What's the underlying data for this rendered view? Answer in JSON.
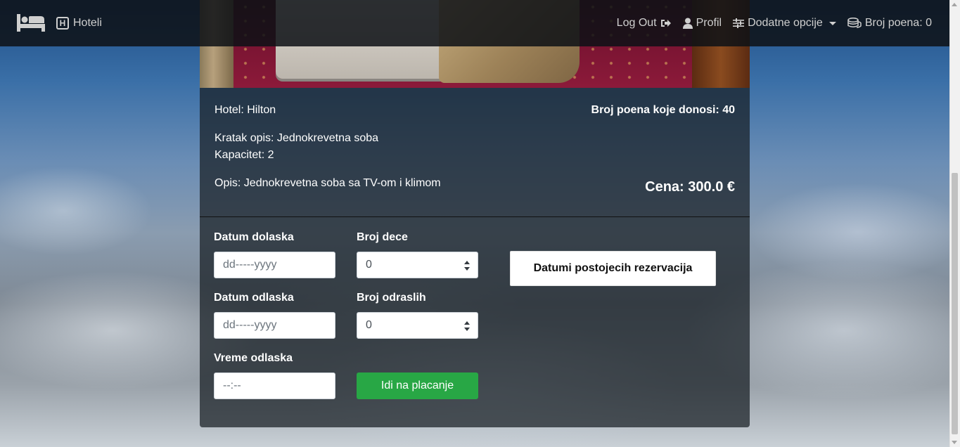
{
  "navbar": {
    "brand_icon": "bed-icon",
    "hotels_icon": "hotel-h-icon",
    "hotels_label": "Hoteli",
    "hotels_icon_letter": "H",
    "logout_label": "Log Out",
    "profile_label": "Profil",
    "options_label": "Dodatne opcije",
    "points_label": "Broj poena: 0"
  },
  "room": {
    "hotel": "Hotel: Hilton",
    "points": "Broj poena koje donosi: 40",
    "short_description": "Kratak opis: Jednokrevetna soba",
    "capacity": "Kapacitet: 2",
    "description": "Opis: Jednokrevetna soba sa TV-om i klimom",
    "price": "Cena: 300.0 €"
  },
  "form": {
    "arrival_label": "Datum dolaska",
    "arrival_placeholder": "dd-----yyyy",
    "departure_label": "Datum odlaska",
    "departure_placeholder": "dd-----yyyy",
    "departure_time_label": "Vreme odlaska",
    "departure_time_placeholder": "--:--",
    "children_label": "Broj dece",
    "children_value": "0",
    "adults_label": "Broj odraslih",
    "adults_value": "0",
    "existing_reservations_button": "Datumi postojecih rezervacija",
    "pay_button": "Idi na placanje"
  },
  "colors": {
    "pay_button": "#28a745",
    "navbar_bg": "#0e1216"
  }
}
